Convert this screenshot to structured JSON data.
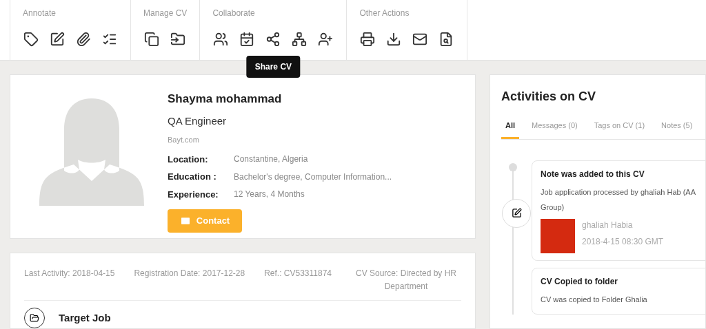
{
  "toolbar": {
    "groups": [
      {
        "label": "Annotate",
        "tools": [
          {
            "kind": "tag"
          },
          {
            "kind": "edit"
          },
          {
            "kind": "attach"
          },
          {
            "kind": "list"
          }
        ]
      },
      {
        "label": "Manage CV",
        "tools": [
          {
            "kind": "copy"
          },
          {
            "kind": "move"
          }
        ]
      },
      {
        "label": "Collaborate",
        "tools": [
          {
            "kind": "review"
          },
          {
            "kind": "task"
          },
          {
            "kind": "share"
          },
          {
            "kind": "network"
          },
          {
            "kind": "forward"
          }
        ]
      },
      {
        "label": "Other Actions",
        "tools": [
          {
            "kind": "print"
          },
          {
            "kind": "download"
          },
          {
            "kind": "email"
          },
          {
            "kind": "preview"
          }
        ]
      }
    ]
  },
  "tooltip": "Share CV",
  "profile": {
    "name": "Shayma mohammad",
    "title": "QA Engineer",
    "source": "Bayt.com",
    "details": [
      {
        "label": "Location:",
        "value": "Constantine, Algeria"
      },
      {
        "label": "Education :",
        "value": "Bachelor's degree, Computer Information..."
      },
      {
        "label": "Experience:",
        "value": "12 Years, 4 Months"
      }
    ],
    "contact_button": "Contact"
  },
  "meta": [
    "Last Activity: 2018-04-15",
    "Registration Date: 2017-12-28",
    "Ref.: CV53311874",
    "CV Source: Directed by HR Department"
  ],
  "section_title": "Target Job",
  "activities": {
    "title": "Activities on CV",
    "tabs": [
      {
        "label": "All",
        "selected": true
      },
      {
        "label": "Messages (0)",
        "selected": false
      },
      {
        "label": "Tags on CV (1)",
        "selected": false
      },
      {
        "label": "Notes (5)",
        "selected": false
      }
    ],
    "items": [
      {
        "title": "Note was added to this CV",
        "body": "Job application processed by ghaliah Hab (AA Group)",
        "author": "ghaliah Habia",
        "date": "2018-4-15 08:30 GMT"
      },
      {
        "title": "CV Copied to folder",
        "body": "CV was copied to Folder Ghalia"
      }
    ]
  }
}
